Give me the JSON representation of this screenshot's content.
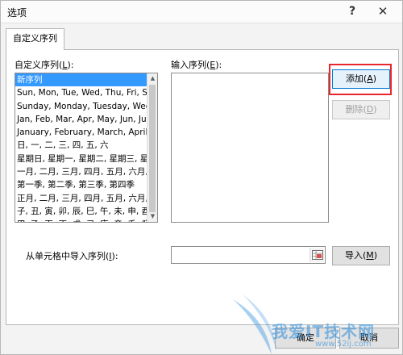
{
  "window": {
    "title": "选项",
    "help": "?",
    "close": "✕"
  },
  "tabs": [
    {
      "label": "自定义序列",
      "active": true
    }
  ],
  "custom_lists": {
    "label_pre": "自定义序列(",
    "label_key": "L",
    "label_post": "):",
    "items": [
      "新序列",
      "Sun, Mon, Tue, Wed, Thu, Fri, S",
      "Sunday, Monday, Tuesday, Wed",
      "Jan, Feb, Mar, Apr, May, Jun, Ju",
      "January, February, March, April,",
      "日, 一, 二, 三, 四, 五, 六",
      "星期日, 星期一, 星期二, 星期三, 星",
      "一月, 二月, 三月, 四月, 五月, 六月,",
      "第一季, 第二季, 第三季, 第四季",
      "正月, 二月, 三月, 四月, 五月, 六月,",
      "子, 丑, 寅, 卯, 辰, 巳, 午, 未, 申, 酉",
      "甲, 乙, 丙, 丁, 戊, 己, 庚, 辛, 壬, 癸"
    ],
    "selected_index": 0
  },
  "input_list": {
    "label_pre": "输入序列(",
    "label_key": "E",
    "label_post": "):",
    "value": ""
  },
  "buttons": {
    "add_pre": "添加(",
    "add_key": "A",
    "add_post": ")",
    "delete_pre": "删除(",
    "delete_key": "D",
    "delete_post": ")",
    "import_pre": "导入(",
    "import_key": "M",
    "import_post": ")",
    "ok": "确定",
    "cancel": "取消"
  },
  "import": {
    "label_pre": "从单元格中导入序列(",
    "label_key": "I",
    "label_post": "):",
    "value": ""
  },
  "watermark": {
    "text": "我爱IT技术网",
    "url": "www.52ij.com"
  },
  "colors": {
    "selection": "#3399ff",
    "highlight": "#e8262d",
    "default_button_border": "#0078d7"
  }
}
